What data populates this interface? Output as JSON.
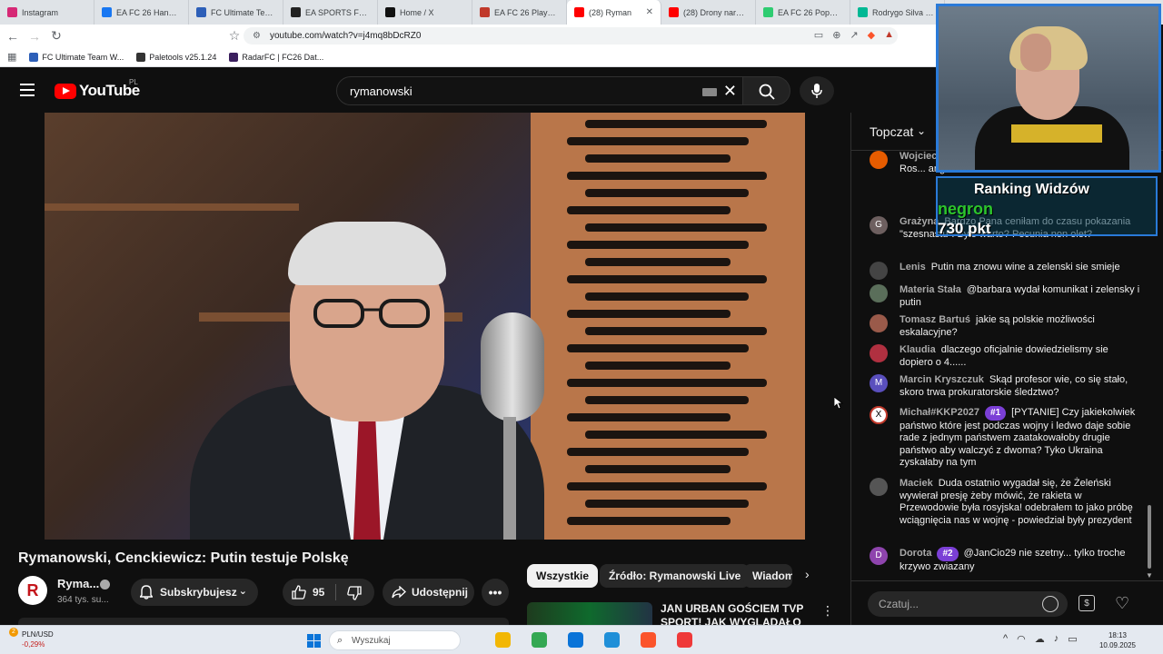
{
  "browser": {
    "tabs": [
      {
        "title": "Instagram",
        "color": "#d62976"
      },
      {
        "title": "EA FC 26 Handel, Za",
        "color": "#1877f2"
      },
      {
        "title": "FC Ultimate Team W",
        "color": "#2d5fb8"
      },
      {
        "title": "EA SPORTS FC™ 26",
        "color": "#222222"
      },
      {
        "title": "Home / X",
        "color": "#111111"
      },
      {
        "title": "EA FC 26 Players, Pl",
        "color": "#c0392b"
      },
      {
        "title": "(28) Ryman",
        "color": "#ff0000",
        "active": true
      },
      {
        "title": "(28) Drony naruszyl",
        "color": "#ff0000"
      },
      {
        "title": "EA FC 26 Popular Pl",
        "color": "#2ecc71"
      },
      {
        "title": "Rodrygo Silva de G",
        "color": "#00b894"
      }
    ],
    "url": "youtube.com/watch?v=j4mq8bDcRZ0",
    "bookmarks": [
      {
        "label": "FC Ultimate Team W...",
        "color": "#2d5fb8"
      },
      {
        "label": "Paletools v25.1.24",
        "color": "#333333"
      },
      {
        "label": "RadarFC | FC26 Dat...",
        "color": "#3b1f5e"
      }
    ]
  },
  "youtube": {
    "logo": "YouTube",
    "country": "PL",
    "search_value": "rymanowski"
  },
  "video": {
    "title": "Rymanowski, Cenckiewicz: Putin testuje Polskę",
    "channel_name": "Ryma...",
    "channel_initial": "R",
    "subscribers": "364 tys. su...",
    "subscribe_label": "Subskrybujesz",
    "likes": "95",
    "share_label": "Udostępnij"
  },
  "chips": [
    "Wszystkie",
    "Źródło: Rymanowski Live",
    "Wiadom"
  ],
  "recommendation": {
    "title": "JAN URBAN GOŚCIEM TVP SPORT! JAK WYGLĄDAŁO"
  },
  "chat": {
    "mode": "Topczat",
    "input_placeholder": "Czatuj...",
    "messages": [
      {
        "author": "Wojciech",
        "text": "w telewizji... czasowym ... ataków przez Ros... angażow...",
        "avatar": "",
        "avatar_color": "#e65c00"
      },
      {
        "author": "Grażyna",
        "text": "Bardzo Pana ceniłam do czasu pokazania \"szesnastu\"! Było warto? Pecunia non olet?",
        "avatar": "G",
        "avatar_color": "#6d5f5f"
      },
      {
        "author": "Lenis",
        "text": "Putin ma znowu wine a zelenski sie smieje",
        "avatar": "",
        "avatar_color": "#444444"
      },
      {
        "author": "Materia Stała",
        "text": "@barbara wydał komunikat i zelensky i putin",
        "avatar": "",
        "avatar_color": "#5a6e5a"
      },
      {
        "author": "Tomasz Bartuś",
        "text": "jakie są polskie możliwości eskalacyjne?",
        "avatar": "",
        "avatar_color": "#9a5a4a"
      },
      {
        "author": "Klaudia",
        "text": "dlaczego oficjalnie dowiedzielismy sie dopiero o 4......",
        "avatar": "",
        "avatar_color": "#b03040"
      },
      {
        "author": "Marcin Kryszczuk",
        "text": "Skąd profesor wie, co się stało, skoro trwa prokuratorskie śledztwo?",
        "avatar": "M",
        "avatar_color": "#5a4fbd"
      },
      {
        "author": "Michał#KKP2027",
        "badge": "#1",
        "text": "[PYTANIE] Czy jakiekolwiek państwo które jest podczas wojny i ledwo daje sobie rade z jednym państwem zaatakowałoby drugie państwo aby walczyć z dwoma? Tyko Ukraina zyskałaby na tym",
        "avatar": "X",
        "avatar_color": "#ffffff"
      },
      {
        "author": "Maciek",
        "text": "Duda ostatnio wygadał się, że Żeleński wywierał presję żeby mówić, że rakieta w Przewodowie była rosyjska! odebrałem to jako próbę wciągnięcia nas w wojnę - powiedział były prezydent",
        "avatar": "",
        "avatar_color": "#555555"
      },
      {
        "author": "Dorota",
        "badge": "#2",
        "text": "@JanCio29 nie szetny... tylko troche krzywo zwiazany",
        "avatar": "D",
        "avatar_color": "#8e44ad"
      }
    ]
  },
  "overlay": {
    "title": "Ranking Widzów",
    "user": "negron",
    "points": "730 pkt"
  },
  "taskbar": {
    "currency_label": "PLN/USD",
    "currency_change": "-0,29%",
    "notification_count": "2",
    "search_placeholder": "Wyszukaj",
    "time": "18:13",
    "date": "10.09.2025",
    "apps": [
      {
        "name": "file-explorer-icon",
        "color": "#f2b705"
      },
      {
        "name": "chrome-icon",
        "color": "#34a853"
      },
      {
        "name": "vscode-icon",
        "color": "#0a74d8"
      },
      {
        "name": "edge-icon",
        "color": "#1f8fd8"
      },
      {
        "name": "brave-icon",
        "color": "#fb542b"
      },
      {
        "name": "vivaldi-icon",
        "color": "#ef3939"
      }
    ]
  }
}
